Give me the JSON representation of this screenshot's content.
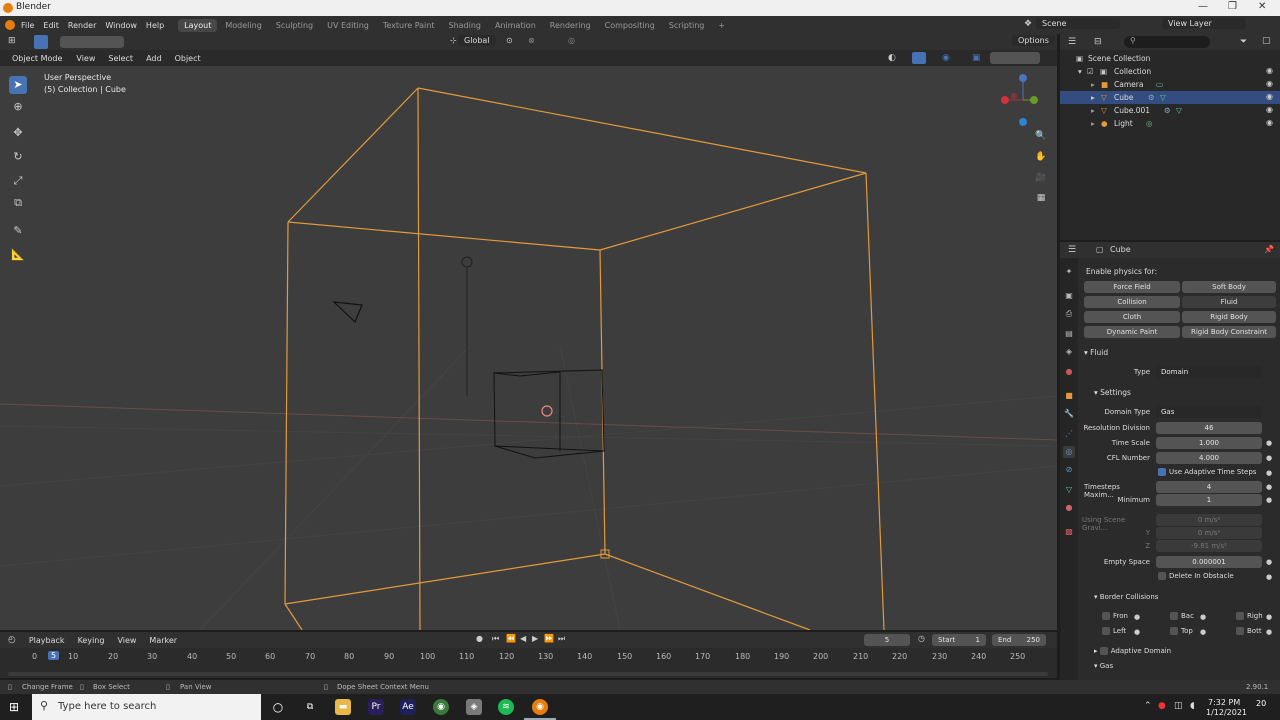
{
  "window": {
    "title": "Blender",
    "controls": [
      "—",
      "❐",
      "✕"
    ]
  },
  "menubar": {
    "menus": [
      "File",
      "Edit",
      "Render",
      "Window",
      "Help"
    ],
    "workspaces": [
      "Layout",
      "Modeling",
      "Sculpting",
      "UV Editing",
      "Texture Paint",
      "Shading",
      "Animation",
      "Rendering",
      "Compositing",
      "Scripting"
    ],
    "add_workspace": "+",
    "scene": "Scene",
    "view_layer": "View Layer"
  },
  "viewport_toolbar": {
    "transform_orientation": "Global",
    "options": "Options"
  },
  "viewport_header": {
    "mode": "Object Mode",
    "menus": [
      "View",
      "Select",
      "Add",
      "Object"
    ]
  },
  "viewport": {
    "perspective": "User Perspective",
    "context": "(5) Collection | Cube"
  },
  "timeline": {
    "menus": [
      "Playback",
      "Keying",
      "View",
      "Marker"
    ],
    "current_frame": "5",
    "start_label": "Start",
    "start": "1",
    "end_label": "End",
    "end": "250",
    "ticks": [
      "0",
      "5",
      "10",
      "20",
      "30",
      "40",
      "50",
      "60",
      "70",
      "80",
      "90",
      "100",
      "110",
      "120",
      "130",
      "140",
      "150",
      "160",
      "170",
      "180",
      "190",
      "200",
      "210",
      "220",
      "230",
      "240",
      "250"
    ]
  },
  "statusbar": {
    "left": "Change Frame",
    "mid1": "Box Select",
    "mid2": "Pan View",
    "mid3": "Dope Sheet Context Menu",
    "version": "2.90.1"
  },
  "taskbar": {
    "search_placeholder": "Type here to search",
    "time": "7:32 PM",
    "date": "1/12/2021",
    "notifications": "20"
  },
  "outliner": {
    "items": [
      {
        "label": "Scene Collection",
        "selected": false
      },
      {
        "label": "Collection",
        "selected": false
      },
      {
        "label": "Camera",
        "selected": false
      },
      {
        "label": "Cube",
        "selected": true
      },
      {
        "label": "Cube.001",
        "selected": false
      },
      {
        "label": "Light",
        "selected": false
      }
    ]
  },
  "properties": {
    "object_name": "Cube",
    "enable_physics": "Enable physics for:",
    "physics_buttons": [
      "Force Field",
      "Soft Body",
      "Collision",
      "Fluid",
      "Cloth",
      "Rigid Body",
      "Dynamic Paint",
      "Rigid Body Constraint"
    ],
    "fluid": {
      "panel": "Fluid",
      "type_label": "Type",
      "type_value": "Domain",
      "settings": "Settings",
      "domain_type_label": "Domain Type",
      "domain_type_value": "Gas",
      "resolution_label": "Resolution Division",
      "resolution_value": "46",
      "time_scale_label": "Time Scale",
      "time_scale_value": "1.000",
      "cfl_label": "CFL Number",
      "cfl_value": "4.000",
      "adaptive_label": "Use Adaptive Time Steps",
      "timesteps_max_label": "Timesteps Maxim...",
      "timesteps_max_value": "4",
      "minimum_label": "Minimum",
      "minimum_value": "1",
      "gravity_label": "Using Scene Gravi...",
      "gravity_x": "0 m/s²",
      "y_label": "Y",
      "gravity_y": "0 m/s²",
      "z_label": "Z",
      "gravity_z": "-9.81 m/s²",
      "empty_space_label": "Empty Space",
      "empty_space_value": "0.000001",
      "delete_obstacle": "Delete In Obstacle",
      "border_collisions": "Border Collisions",
      "border_front": "Fron",
      "border_back": "Bac",
      "border_right": "Righ",
      "border_left": "Left",
      "border_top": "Top",
      "border_bottom": "Bott",
      "adaptive_domain": "Adaptive Domain",
      "gas": "Gas"
    }
  },
  "colors": {
    "accent": "#4772b3",
    "selected_outline": "#e39a3c",
    "viewport_bg": "#3d3d3d"
  }
}
